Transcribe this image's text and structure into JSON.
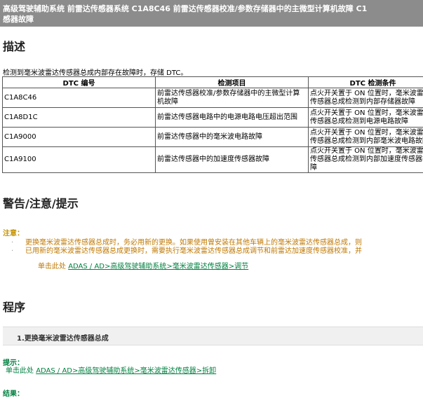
{
  "header": {
    "line1": "高级驾驶辅助系统  前雷达传感器系统  C1A8C46  前雷达传感器校准/参数存储器中的主微型计算机故障  C1",
    "line2": "感器故障"
  },
  "description": {
    "heading": "描述",
    "intro": "检测到毫米波雷达传感器总成内部存在故障时，存储 DTC。",
    "table": {
      "headers": [
        "DTC 编号",
        "检测项目",
        "DTC 检测条件"
      ],
      "rows": [
        {
          "code": "C1A8C46",
          "item": "前雷达传感器校准/参数存储器中的主微型计算机故障",
          "cond": "点火开关置于 ON 位置时，毫米波雷达传感器总成检测到内部存储器故障"
        },
        {
          "code": "C1A8D1C",
          "item": "前雷达传感器电路中的电源电路电压超出范围",
          "cond": "点火开关置于 ON 位置时，毫米波雷达传感器总成检测到电源电路故障"
        },
        {
          "code": "C1A9000",
          "item": "前雷达传感器中的毫米波电路故障",
          "cond": "点火开关置于 ON 位置时，毫米波雷达传感器总成检测到内部毫米波电路故障"
        },
        {
          "code": "C1A9100",
          "item": "前雷达传感器中的加速度传感器故障",
          "cond": "点火开关置于 ON 位置时，毫米波雷达传感器总成检测到内部加速度传感器故障"
        }
      ]
    }
  },
  "warnings": {
    "heading": "警告/注意/提示",
    "note_label": "注意：",
    "items": [
      "更换毫米波雷达传感器总成时，务必用新的更换。如果使用曾安装在其他车辆上的毫米波雷达传感器总成，则",
      "已用新的毫米波雷达传感器总成更换时，需要执行毫米波雷达传感器总成调节和前雷达加速度传感器校准，并"
    ],
    "link_prefix": "单击此处",
    "link_text": "ADAS / AD>高级驾驶辅助系统>毫米波雷达传感器>调节"
  },
  "procedure": {
    "heading": "程序",
    "step1": "1.更换毫米波雷达传感器总成",
    "hint_label": "提示：",
    "hint_prefix": "单击此处",
    "hint_link": "ADAS / AD>高级驾驶辅助系统>毫米波雷达传感器>拆卸",
    "result_label": "结果："
  },
  "colors": {
    "title_bg": "#8c8c8c",
    "note": "#c07800",
    "link": "#008040"
  }
}
